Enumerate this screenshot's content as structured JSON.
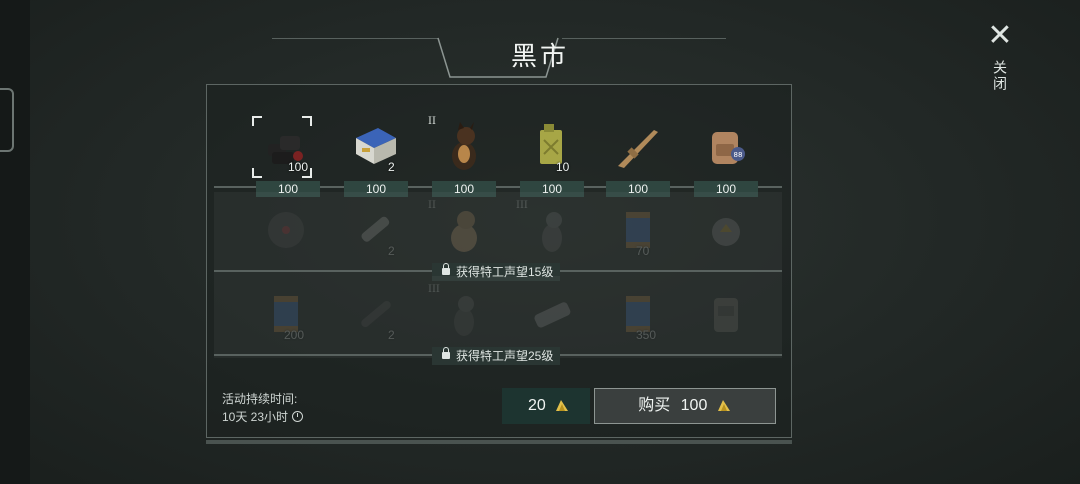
{
  "title": "黑市",
  "close_label": "关闭",
  "row1": {
    "items": [
      {
        "name": "dark-material-bundle",
        "qty": "100",
        "tier": ""
      },
      {
        "name": "battery-pack",
        "qty": "2",
        "tier": ""
      },
      {
        "name": "dog-companion",
        "qty": "",
        "tier": "II"
      },
      {
        "name": "fuel-jerrycan",
        "qty": "10",
        "tier": ""
      },
      {
        "name": "assault-rifle",
        "qty": "",
        "tier": ""
      },
      {
        "name": "backpack",
        "qty": "",
        "tier": ""
      }
    ],
    "prices": [
      "100",
      "100",
      "100",
      "100",
      "100",
      "100"
    ]
  },
  "row2": {
    "items": [
      {
        "name": "vinyl-record",
        "qty": "",
        "tier": ""
      },
      {
        "name": "pipe-parts",
        "qty": "2",
        "tier": ""
      },
      {
        "name": "dog-companion",
        "qty": "",
        "tier": "II"
      },
      {
        "name": "dog-companion",
        "qty": "",
        "tier": "III"
      },
      {
        "name": "blue-canister",
        "qty": "70",
        "tier": ""
      },
      {
        "name": "gear-mask",
        "qty": "",
        "tier": ""
      }
    ],
    "lock_text": "获得特工声望15级"
  },
  "row3": {
    "items": [
      {
        "name": "blue-canister",
        "qty": "200",
        "tier": ""
      },
      {
        "name": "rifle-scope",
        "qty": "2",
        "tier": ""
      },
      {
        "name": "dog-companion",
        "qty": "",
        "tier": "III"
      },
      {
        "name": "engine-part",
        "qty": "",
        "tier": ""
      },
      {
        "name": "blue-canister",
        "qty": "350",
        "tier": ""
      },
      {
        "name": "armor-vest",
        "qty": "",
        "tier": ""
      }
    ],
    "lock_text": "获得特工声望25级"
  },
  "footer": {
    "duration_label": "活动持续时间:",
    "duration_value": "10天 23小时",
    "balance": "20",
    "buy_label": "购买",
    "buy_price": "100"
  },
  "colors": {
    "accent": "#2f4640",
    "coin": "#e3c04a",
    "background": "#252b29"
  }
}
